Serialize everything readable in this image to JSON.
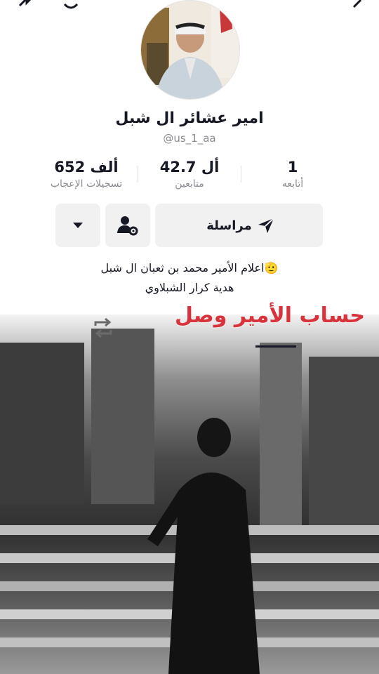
{
  "profile": {
    "name": "امير عشائر ال شبل",
    "handle": "@us_1_aa"
  },
  "stats": {
    "following": {
      "value": "1",
      "label": "أتابعه"
    },
    "followers": {
      "value": "42.7 أل",
      "label": "متابعين"
    },
    "likes": {
      "value": "652 ألف",
      "label": "تسجيلات الإعجاب"
    }
  },
  "actions": {
    "message_label": "مراسلة",
    "icons": [
      "send-icon",
      "user-settings-icon",
      "caret-down-icon"
    ]
  },
  "bio": {
    "line1": "اعلام الأمير محمد بن ثعبان ال شبل🫡",
    "line2": "هدية كرار الشبلاوي"
  },
  "video": {
    "overlay_text": "حساب الأمير وصل",
    "icons": [
      "repost-icon"
    ]
  },
  "colors": {
    "background": "#ffffff",
    "button_bg": "#f1f1f2",
    "text_primary": "#161823",
    "text_secondary": "#8a8b91",
    "overlay_text": "#d8323c"
  }
}
